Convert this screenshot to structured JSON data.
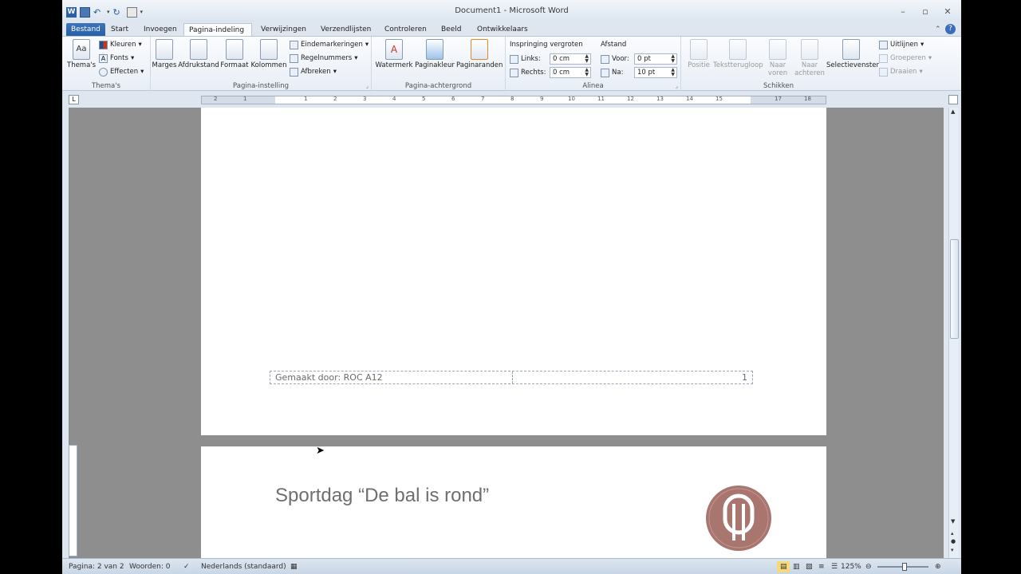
{
  "window": {
    "title": "Document1 - Microsoft Word"
  },
  "tabs": [
    {
      "label": "Bestand"
    },
    {
      "label": "Start"
    },
    {
      "label": "Invoegen"
    },
    {
      "label": "Pagina-indeling"
    },
    {
      "label": "Verwijzingen"
    },
    {
      "label": "Verzendlijsten"
    },
    {
      "label": "Controleren"
    },
    {
      "label": "Beeld"
    },
    {
      "label": "Ontwikkelaars"
    }
  ],
  "ribbon": {
    "themes": {
      "label": "Thema's",
      "big": "Thema's",
      "colors": "Kleuren",
      "fonts": "Fonts",
      "effects": "Effecten"
    },
    "page_setup": {
      "label": "Pagina-instelling",
      "margins": "Marges",
      "orientation": "Afdrukstand",
      "size": "Formaat",
      "columns": "Kolommen",
      "breaks": "Eindemarkeringen",
      "line_numbers": "Regelnummers",
      "hyphenation": "Afbreken"
    },
    "page_background": {
      "label": "Pagina-achtergrond",
      "watermark": "Watermerk",
      "page_color": "Paginakleur",
      "page_borders": "Paginaranden"
    },
    "paragraph": {
      "label": "Alinea",
      "indent_title": "Inspringing vergroten",
      "spacing_title": "Afstand",
      "left_label": "Links:",
      "left_value": "0 cm",
      "right_label": "Rechts:",
      "right_value": "0 cm",
      "before_label": "Voor:",
      "before_value": "0 pt",
      "after_label": "Na:",
      "after_value": "10 pt"
    },
    "arrange": {
      "label": "Schikken",
      "position": "Positie",
      "wrap": "Tekstterugloop",
      "forward1": "Naar",
      "forward2": "voren",
      "backward1": "Naar",
      "backward2": "achteren",
      "selection": "Selectievenster",
      "align": "Uitlijnen",
      "group": "Groeperen",
      "rotate": "Draaien"
    }
  },
  "ruler": {
    "numbers": [
      "2",
      "1",
      "1",
      "2",
      "1",
      "2",
      "3",
      "4",
      "5",
      "6",
      "7",
      "8",
      "9",
      "10",
      "11",
      "12",
      "13",
      "14",
      "15",
      "17",
      "18"
    ]
  },
  "document": {
    "footer_left": "Gemaakt door: ROC A12",
    "footer_right": "1",
    "heading": "Sportdag “De bal is rond”"
  },
  "statusbar": {
    "page": "Pagina: 2 van 2",
    "words": "Woorden: 0",
    "language": "Nederlands (standaard)",
    "zoom": "125%"
  }
}
